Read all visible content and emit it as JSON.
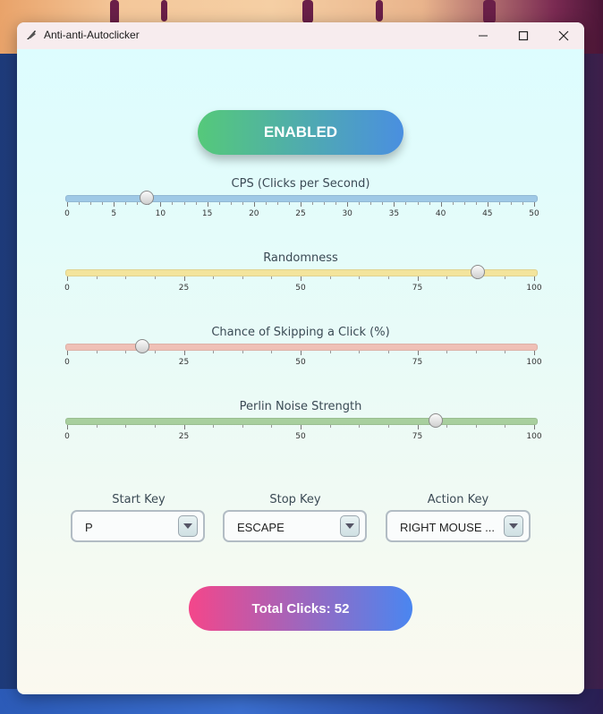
{
  "window": {
    "title": "Anti-anti-Autoclicker",
    "icon": "feather-app-icon",
    "controls": [
      "minimize-icon",
      "maximize-icon",
      "close-icon"
    ]
  },
  "toggle": {
    "label": "ENABLED",
    "gradient": [
      "#55c97a",
      "#4a8fe0"
    ]
  },
  "sliders": [
    {
      "id": "cps",
      "label": "CPS (Clicks per Second)",
      "min": 0,
      "max": 50,
      "value": 8.5,
      "color": "#9fc9e6",
      "major_ticks": [
        "0",
        "5",
        "10",
        "15",
        "20",
        "25",
        "30",
        "35",
        "40",
        "45",
        "50"
      ],
      "minor_per_major": 4
    },
    {
      "id": "randomness",
      "label": "Randomness",
      "min": 0,
      "max": 100,
      "value": 88,
      "color": "#f3e49c",
      "major_ticks": [
        "0",
        "25",
        "50",
        "75",
        "100"
      ],
      "minor_per_major": 4
    },
    {
      "id": "skip",
      "label": "Chance of Skipping a Click (%)",
      "min": 0,
      "max": 100,
      "value": 16,
      "color": "#efc0b6",
      "major_ticks": [
        "0",
        "25",
        "50",
        "75",
        "100"
      ],
      "minor_per_major": 4
    },
    {
      "id": "perlin",
      "label": "Perlin Noise Strength",
      "min": 0,
      "max": 100,
      "value": 79,
      "color": "#a8cf9e",
      "major_ticks": [
        "0",
        "25",
        "50",
        "75",
        "100"
      ],
      "minor_per_major": 4
    }
  ],
  "keys": [
    {
      "id": "start",
      "label": "Start Key",
      "value": "P"
    },
    {
      "id": "stop",
      "label": "Stop Key",
      "value": "ESCAPE"
    },
    {
      "id": "action",
      "label": "Action Key",
      "value": "RIGHT MOUSE ..."
    }
  ],
  "counter": {
    "label": "Total Clicks: 52",
    "gradient": [
      "#f4468a",
      "#4a86f0"
    ]
  }
}
